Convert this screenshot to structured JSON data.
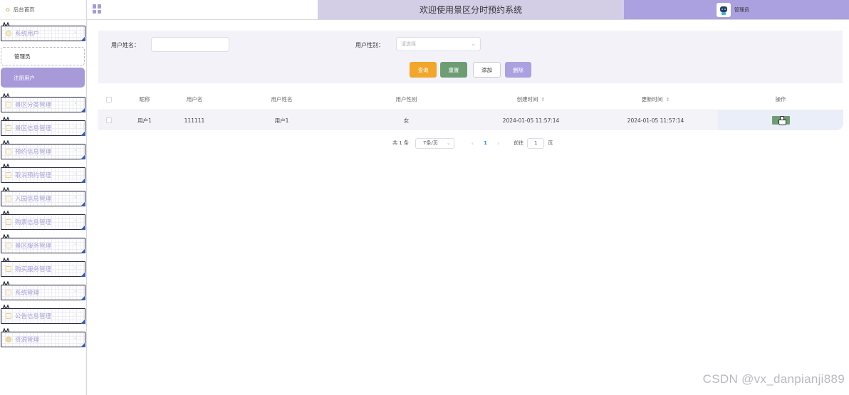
{
  "sidebar": {
    "home": "后台首页",
    "menus": [
      {
        "label": "系统用户",
        "icon": "person"
      },
      {
        "label": "景区分类管理",
        "icon": "square"
      },
      {
        "label": "景区信息管理",
        "icon": "square"
      },
      {
        "label": "预约信息管理",
        "icon": "square"
      },
      {
        "label": "取消预约管理",
        "icon": "square"
      },
      {
        "label": "入园信息管理",
        "icon": "square"
      },
      {
        "label": "购票信息管理",
        "icon": "square"
      },
      {
        "label": "景区服务管理",
        "icon": "square"
      },
      {
        "label": "购买服务管理",
        "icon": "square"
      },
      {
        "label": "系统管理",
        "icon": "square"
      },
      {
        "label": "公告信息管理",
        "icon": "square"
      },
      {
        "label": "资源管理",
        "icon": "dot"
      }
    ],
    "sub_items": {
      "admin": "管理员",
      "registered_user": "注册用户"
    }
  },
  "header": {
    "title": "欢迎使用景区分时预约系统",
    "user": "管理员"
  },
  "search": {
    "name_label": "用户姓名：",
    "name_value": "",
    "gender_label": "用户性别：",
    "gender_placeholder": "请选择",
    "buttons": {
      "query": "查询",
      "reset": "重置",
      "add": "添加",
      "delete": "删除"
    }
  },
  "table": {
    "headers": [
      "昵称",
      "用户名",
      "用户姓名",
      "用户性别",
      "创建时间",
      "更新时间",
      "操作"
    ],
    "rows": [
      {
        "nickname": "用户1",
        "username": "111111",
        "realname": "用户1",
        "gender": "女",
        "created": "2024-01-05 11:57:14",
        "updated": "2024-01-05 11:57:14"
      }
    ]
  },
  "pagination": {
    "total": "共 1 条",
    "page_size": "7条/页",
    "current_page": "1",
    "goto_label": "前往",
    "goto_value": "1",
    "page_unit": "页"
  },
  "watermark": "CSDN @vx_danpianji889",
  "colors": {
    "accent": "#aba0e0",
    "title_bar": "#d4cde6",
    "query": "#f2a62a",
    "reset": "#6e9d74",
    "active_menu": "#a89ad8"
  }
}
